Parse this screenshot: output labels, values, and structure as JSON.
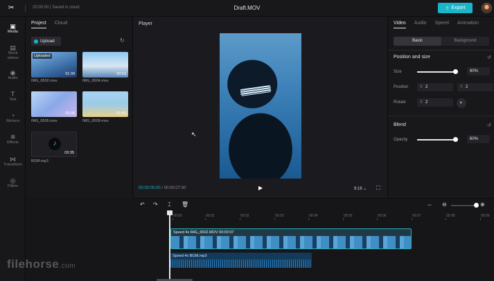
{
  "header": {
    "save_status": "20:00:00 | Saved in cloud",
    "title": "Draft.MOV",
    "export_label": "Export",
    "logo": "capcut-logo"
  },
  "nav": [
    {
      "icon": "▣",
      "label": "Media"
    },
    {
      "icon": "▤",
      "label": "Stock videos"
    },
    {
      "icon": "◉",
      "label": "Audio"
    },
    {
      "icon": "T",
      "label": "Text"
    },
    {
      "icon": "◔",
      "label": "Stickers"
    },
    {
      "icon": "✲",
      "label": "Effects"
    },
    {
      "icon": "⋈",
      "label": "Transitions"
    },
    {
      "icon": "◎",
      "label": "Filters"
    }
  ],
  "media": {
    "tabs": [
      "Project",
      "Cloud"
    ],
    "upload_label": "Upload",
    "items": [
      {
        "name": "IMG_6502.mov",
        "duration": "01:39",
        "badge": "Uploaded"
      },
      {
        "name": "IMG_6504.mov",
        "duration": "00:53"
      },
      {
        "name": "IMG_6505.mov",
        "duration": "02:06"
      },
      {
        "name": "IMG_6509.mov",
        "duration": "02:43"
      },
      {
        "name": "BGM.mp3",
        "duration": "03:35"
      }
    ]
  },
  "player": {
    "title": "Player",
    "current": "00:00:00:00",
    "total": " / 00:00:07:00",
    "ratio": "9:16 ⌄"
  },
  "props": {
    "tabs": [
      "Video",
      "Audio",
      "Speed",
      "Animation"
    ],
    "seg": [
      "Basic",
      "Background"
    ],
    "position_size": "Position and size",
    "size_label": "Size",
    "size_value": "60%",
    "size_level": 0.95,
    "position_label": "Position",
    "pos_x": "2",
    "pos_y": "2",
    "rotate_label": "Rotate",
    "rotate_value": "2",
    "blend": "Blend",
    "opacity_label": "Opacity",
    "opacity_value": "60%",
    "opacity_level": 0.95
  },
  "timeline": {
    "ticks": [
      "00:00",
      "00:01",
      "00:02",
      "00:03",
      "00:04",
      "00:05",
      "00:06",
      "00:07",
      "00:08",
      "00:09"
    ],
    "video_clip": "Speed 4x   IMG_6502.MOV   00:00:07",
    "audio_clip": "Speed 4x   BGM.mp3"
  },
  "watermark": {
    "main": "filehorse",
    "sub": ".com"
  }
}
